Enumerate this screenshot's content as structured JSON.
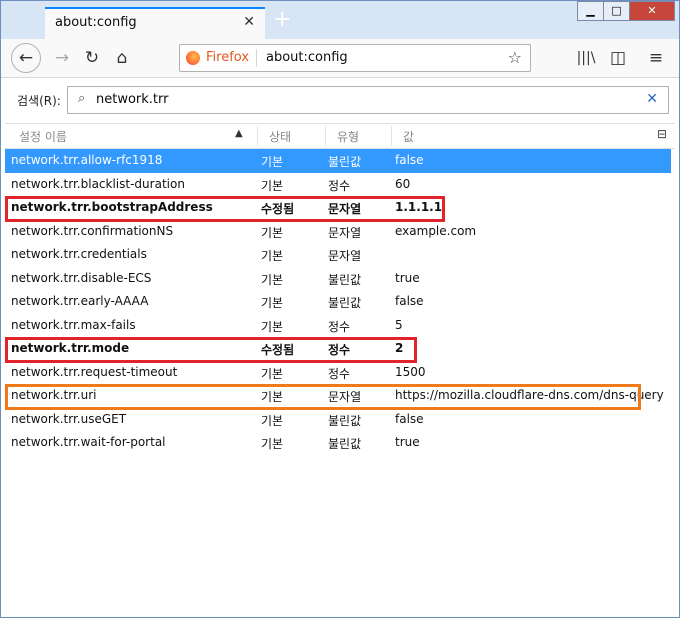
{
  "tab": {
    "title": "about:config"
  },
  "window_controls": {
    "minimize": "▁",
    "maximize": "□",
    "close": "✕"
  },
  "navbar": {
    "identity": "Firefox",
    "url": "about:config"
  },
  "search": {
    "label": "검색(R):",
    "value": "network.trr"
  },
  "columns": {
    "name": "설정 이름",
    "status": "상태",
    "type": "유형",
    "value": "값"
  },
  "rows": [
    {
      "name": "network.trr.allow-rfc1918",
      "status": "기본",
      "type": "불린값",
      "value": "false"
    },
    {
      "name": "network.trr.blacklist-duration",
      "status": "기본",
      "type": "정수",
      "value": "60"
    },
    {
      "name": "network.trr.bootstrapAddress",
      "status": "수정됨",
      "type": "문자열",
      "value": "1.1.1.1"
    },
    {
      "name": "network.trr.confirmationNS",
      "status": "기본",
      "type": "문자열",
      "value": "example.com"
    },
    {
      "name": "network.trr.credentials",
      "status": "기본",
      "type": "문자열",
      "value": ""
    },
    {
      "name": "network.trr.disable-ECS",
      "status": "기본",
      "type": "불린값",
      "value": "true"
    },
    {
      "name": "network.trr.early-AAAA",
      "status": "기본",
      "type": "불린값",
      "value": "false"
    },
    {
      "name": "network.trr.max-fails",
      "status": "기본",
      "type": "정수",
      "value": "5"
    },
    {
      "name": "network.trr.mode",
      "status": "수정됨",
      "type": "정수",
      "value": "2"
    },
    {
      "name": "network.trr.request-timeout",
      "status": "기본",
      "type": "정수",
      "value": "1500"
    },
    {
      "name": "network.trr.uri",
      "status": "기본",
      "type": "문자열",
      "value": "https://mozilla.cloudflare-dns.com/dns-query"
    },
    {
      "name": "network.trr.useGET",
      "status": "기본",
      "type": "불린값",
      "value": "false"
    },
    {
      "name": "network.trr.wait-for-portal",
      "status": "기본",
      "type": "불린값",
      "value": "true"
    }
  ],
  "colors": {
    "selected": "#3399ff",
    "highlight_red": "#e3232a",
    "highlight_orange": "#f07a1a"
  }
}
